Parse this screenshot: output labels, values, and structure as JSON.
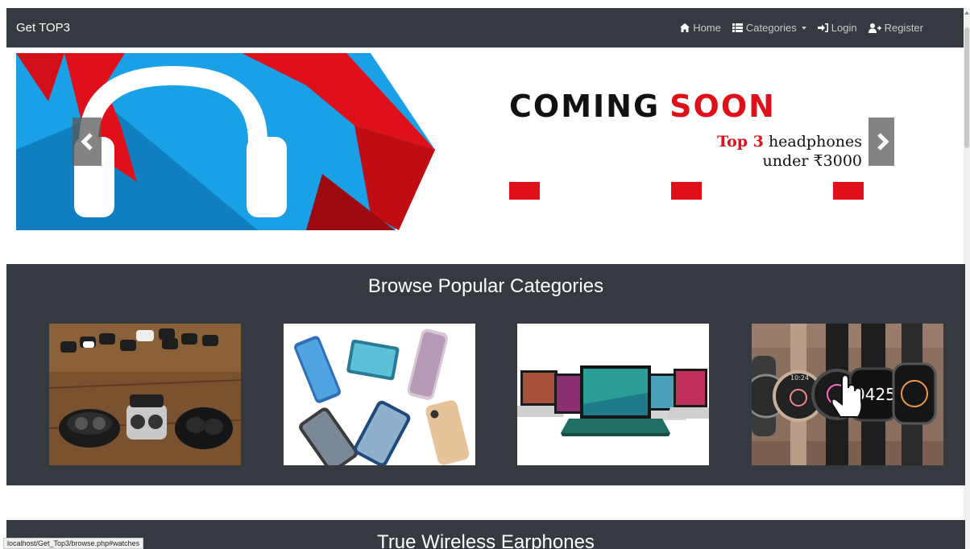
{
  "navbar": {
    "brand": "Get TOP3",
    "items": [
      {
        "label": "Home",
        "icon": "home-icon"
      },
      {
        "label": "Categories",
        "icon": "list-icon",
        "dropdown": true
      },
      {
        "label": "Login",
        "icon": "sign-in-icon"
      },
      {
        "label": "Register",
        "icon": "user-plus-icon"
      }
    ]
  },
  "carousel": {
    "headline_1": "COMING",
    "headline_2": "SOON",
    "tagline_red": "Top 3",
    "tagline_rest": " headphones",
    "tagline_line2": "under ₹3000",
    "active_indicator": 1,
    "indicator_count": 3,
    "colors": {
      "accent": "#e0101a",
      "blue": "#1aa0e6"
    }
  },
  "categories": {
    "title": "Browse Popular Categories",
    "cards": [
      {
        "icon": "earphones-image"
      },
      {
        "icon": "smartphones-image"
      },
      {
        "icon": "laptops-image"
      },
      {
        "icon": "watches-image"
      }
    ]
  },
  "next_section": {
    "title": "True Wireless Earphones"
  },
  "statusbar": {
    "url": "localhost/Get_Top3/browse.php#watches"
  }
}
